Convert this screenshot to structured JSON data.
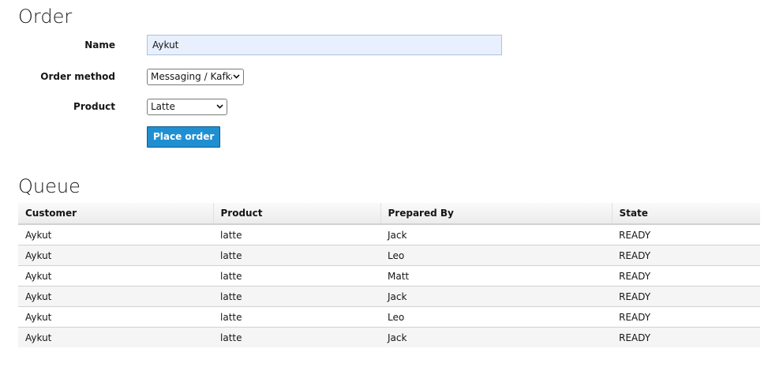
{
  "order": {
    "title": "Order",
    "name_label": "Name",
    "name_value": "Aykut",
    "method_label": "Order method",
    "method_value": "Messaging / Kafka",
    "product_label": "Product",
    "product_value": "Latte",
    "submit_label": "Place order"
  },
  "queue": {
    "title": "Queue",
    "columns": [
      "Customer",
      "Product",
      "Prepared By",
      "State"
    ],
    "rows": [
      [
        "Aykut",
        "latte",
        "Jack",
        "READY"
      ],
      [
        "Aykut",
        "latte",
        "Leo",
        "READY"
      ],
      [
        "Aykut",
        "latte",
        "Matt",
        "READY"
      ],
      [
        "Aykut",
        "latte",
        "Jack",
        "READY"
      ],
      [
        "Aykut",
        "latte",
        "Leo",
        "READY"
      ],
      [
        "Aykut",
        "latte",
        "Jack",
        "READY"
      ]
    ]
  },
  "colors": {
    "primary_button": "#1f8fd1",
    "input_autofill_bg": "#e8f0fe"
  },
  "icons": {
    "select_arrow": "chevron-down-icon"
  }
}
